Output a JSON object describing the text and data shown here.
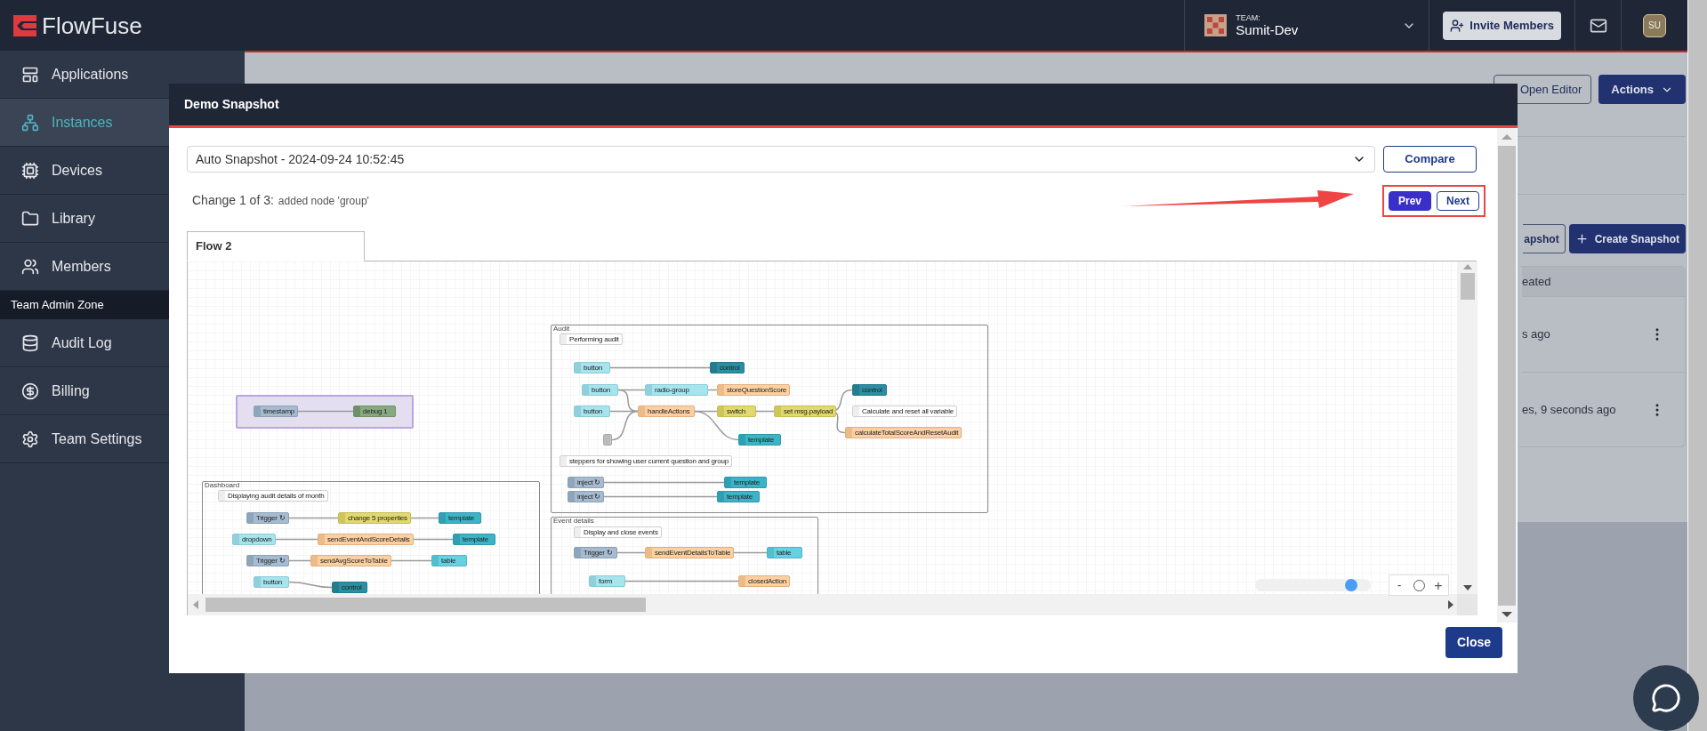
{
  "top_bar": {
    "logo": "FlowFuse",
    "team_label": "TEAM:",
    "team_name": "Sumit-Dev",
    "invite_button": "Invite Members",
    "avatar": "SU"
  },
  "sidebar": {
    "items": [
      {
        "label": "Applications",
        "selected": false
      },
      {
        "label": "Instances",
        "selected": true
      },
      {
        "label": "Devices",
        "selected": false
      },
      {
        "label": "Library",
        "selected": false
      },
      {
        "label": "Members",
        "selected": false
      }
    ],
    "admin_heading": "Team Admin Zone",
    "admin_items": [
      {
        "label": "Audit Log",
        "selected": false
      },
      {
        "label": "Billing",
        "selected": false
      },
      {
        "label": "Team Settings",
        "selected": false
      }
    ]
  },
  "page": {
    "header_buttons": [
      {
        "label": "Open Editor",
        "kind": "outline"
      },
      {
        "label": "Actions",
        "kind": "menu"
      }
    ],
    "snapshot_buttons": [
      {
        "label": "apshot",
        "kind": "outline"
      },
      {
        "label": "Create Snapshot",
        "kind": "create"
      }
    ],
    "table": {
      "column_1": "eated",
      "rows": [
        "s ago",
        "es, 9 seconds ago"
      ]
    }
  },
  "dialog": {
    "title": "Demo Snapshot",
    "snapshot_select": {
      "value": "Auto Snapshot - 2024-09-24 10:52:45"
    },
    "compare_button": "Compare",
    "change": {
      "label": "Change 1 of 3:",
      "detail": "added node 'group'"
    },
    "nav_buttons": [
      {
        "label": "Prev",
        "selected": true
      },
      {
        "label": "Next",
        "selected": false
      }
    ],
    "tabs": [
      {
        "label": "Flow 2",
        "selected": true
      }
    ],
    "flow": {
      "groups": [
        {
          "highlighted": true,
          "nodes": [
            {
              "kind": "inject",
              "label": "timestamp"
            },
            {
              "kind": "debug",
              "label": "debug 1"
            }
          ]
        },
        {
          "highlighted": false,
          "title": "Audit",
          "nodes": [
            {
              "kind": "comment",
              "label": "Performing audit"
            },
            {
              "kind": "ui",
              "label": "button"
            },
            {
              "kind": "control",
              "label": "control"
            },
            {
              "kind": "ui",
              "label": "button"
            },
            {
              "kind": "ui",
              "label": "radio-group"
            },
            {
              "kind": "function",
              "label": "storeQuestionScore"
            },
            {
              "kind": "control",
              "label": "control"
            },
            {
              "kind": "ui",
              "label": "button"
            },
            {
              "kind": "function",
              "label": "handleActions"
            },
            {
              "kind": "change",
              "label": "switch"
            },
            {
              "kind": "change",
              "label": "set msg.payload"
            },
            {
              "kind": "comment",
              "label": "Calculate and reset all variable"
            },
            {
              "kind": "function",
              "label": "calculateTotalScoreAndResetAudit"
            },
            {
              "kind": "status"
            },
            {
              "kind": "template",
              "label": "template"
            },
            {
              "kind": "comment",
              "label": "steppers for showing user current question and group"
            },
            {
              "kind": "inject",
              "label": "inject ↻"
            },
            {
              "kind": "template",
              "label": "template"
            },
            {
              "kind": "inject",
              "label": "inject ↻"
            },
            {
              "kind": "template",
              "label": "template"
            }
          ]
        },
        {
          "highlighted": false,
          "title": "Dashboard",
          "nodes": [
            {
              "kind": "comment",
              "label": "Displaying audit details of month"
            },
            {
              "kind": "inject",
              "label": "Trigger ↻"
            },
            {
              "kind": "change",
              "label": "change 5 properties"
            },
            {
              "kind": "template",
              "label": "template"
            },
            {
              "kind": "ui",
              "label": "dropdown"
            },
            {
              "kind": "function",
              "label": "sendEventAndScoreDetails"
            },
            {
              "kind": "template",
              "label": "template"
            },
            {
              "kind": "inject",
              "label": "Trigger ↻"
            },
            {
              "kind": "function",
              "label": "sendAvgScoreToTable"
            },
            {
              "kind": "table",
              "label": "table"
            },
            {
              "kind": "ui",
              "label": "button"
            },
            {
              "kind": "control",
              "label": "control"
            }
          ]
        },
        {
          "highlighted": false,
          "title": "Event details",
          "nodes": [
            {
              "kind": "comment",
              "label": "Display and close events"
            },
            {
              "kind": "inject",
              "label": "Trigger ↻"
            },
            {
              "kind": "function",
              "label": "sendEventDetailsToTable"
            },
            {
              "kind": "table",
              "label": "table"
            },
            {
              "kind": "ui",
              "label": "form"
            },
            {
              "kind": "function",
              "label": "closedAction"
            }
          ]
        }
      ]
    },
    "zoom": {
      "level": 0.85,
      "out": "-",
      "in": "+"
    },
    "close_button": "Close"
  }
}
